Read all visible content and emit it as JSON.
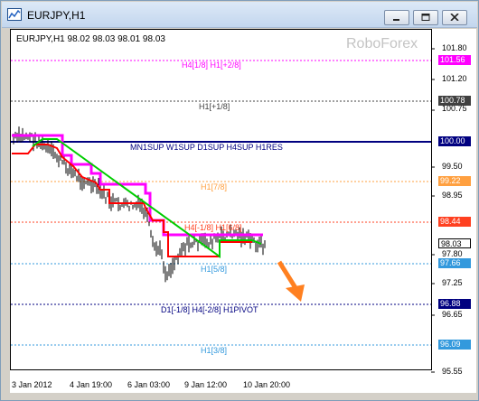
{
  "window": {
    "title": "EURJPY,H1"
  },
  "chart": {
    "symbol_info": "EURJPY,H1  98.02 98.03 98.01 98.03",
    "watermark": "RoboForex",
    "y_ticks": [
      "101.80",
      "101.20",
      "100.75",
      "99.50",
      "98.95",
      "97.80",
      "97.25",
      "96.65",
      "95.55"
    ],
    "x_ticks": [
      "3 Jan 2012",
      "4 Jan 19:00",
      "6 Jan 03:00",
      "9 Jan 12:00",
      "10 Jan 20:00"
    ],
    "levels": [
      {
        "label": "H4[1/8] H1[+2/8]",
        "price": "101.56",
        "color": "#ff00ff"
      },
      {
        "label": "H1[+1/8]",
        "price": "100.78",
        "color": "#404040"
      },
      {
        "label": "MN1SUP W1SUP D1SUP H4SUP H1RES",
        "price": "100.00",
        "color": "#000080"
      },
      {
        "label": "H1[7/8]",
        "price": "99.22",
        "color": "#ffa040"
      },
      {
        "label": "H4[-1/8] H1[6/8]",
        "price": "98.44",
        "color": "#ff4020"
      },
      {
        "label": "",
        "price": "98.03",
        "color": "#000000"
      },
      {
        "label": "H1[5/8]",
        "price": "97.66",
        "color": "#3399dd"
      },
      {
        "label": "D1[-1/8] H4[-2/8] H1PIVOT",
        "price": "96.88",
        "color": "#000080"
      },
      {
        "label": "H1[3/8]",
        "price": "96.09",
        "color": "#3399dd"
      }
    ]
  },
  "chart_data": {
    "type": "line",
    "title": "EURJPY,H1",
    "xlabel": "",
    "ylabel": "",
    "ylim": [
      95.5,
      102.0
    ],
    "categories": [
      "3 Jan 2012",
      "4 Jan 19:00",
      "6 Jan 03:00",
      "9 Jan 12:00",
      "10 Jan 20:00"
    ],
    "series": [
      {
        "values": [
          100.05,
          99.8,
          99.1,
          98.3,
          97.85,
          98.1
        ]
      },
      {
        "values": [
          100.1,
          99.9,
          99.0,
          98.6,
          98.2,
          98.2
        ]
      }
    ]
  },
  "colors": {
    "accent": "#ff00ff",
    "price_red": "#ff0000",
    "green": "#00cc00"
  }
}
